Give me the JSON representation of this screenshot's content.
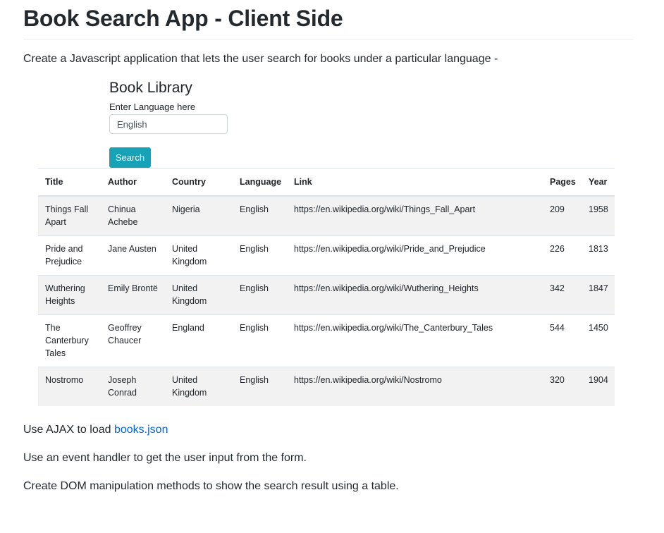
{
  "readme": {
    "title": "Book Search App - Client Side",
    "intro": "Create a Javascript application that lets the user search for books under a particular language -"
  },
  "app": {
    "title": "Book Library",
    "input_label": "Enter Language here",
    "input_value": "English",
    "search_label": "Search",
    "search_button_color": "#17a2b8"
  },
  "table": {
    "headers": {
      "title": "Title",
      "author": "Author",
      "country": "Country",
      "language": "Language",
      "link": "Link",
      "pages": "Pages",
      "year": "Year"
    },
    "rows": [
      {
        "title": "Things Fall Apart",
        "author": "Chinua Achebe",
        "country": "Nigeria",
        "language": "English",
        "link": "https://en.wikipedia.org/wiki/Things_Fall_Apart",
        "pages": "209",
        "year": "1958"
      },
      {
        "title": "Pride and Prejudice",
        "author": "Jane Austen",
        "country": "United Kingdom",
        "language": "English",
        "link": "https://en.wikipedia.org/wiki/Pride_and_Prejudice",
        "pages": "226",
        "year": "1813"
      },
      {
        "title": "Wuthering Heights",
        "author": "Emily Brontë",
        "country": "United Kingdom",
        "language": "English",
        "link": "https://en.wikipedia.org/wiki/Wuthering_Heights",
        "pages": "342",
        "year": "1847"
      },
      {
        "title": "The Canterbury Tales",
        "author": "Geoffrey Chaucer",
        "country": "England",
        "language": "English",
        "link": "https://en.wikipedia.org/wiki/The_Canterbury_Tales",
        "pages": "544",
        "year": "1450"
      },
      {
        "title": "Nostromo",
        "author": "Joseph Conrad",
        "country": "United Kingdom",
        "language": "English",
        "link": "https://en.wikipedia.org/wiki/Nostromo",
        "pages": "320",
        "year": "1904"
      }
    ]
  },
  "instructions": {
    "ajax_prefix": "Use AJAX to load ",
    "ajax_link": "books.json",
    "event_handler": "Use an event handler to get the user input from the form.",
    "dom_methods": "Create DOM manipulation methods to show the search result using a table."
  },
  "colors": {
    "link": "#0366d6",
    "stripe": "#f2f2f2"
  }
}
